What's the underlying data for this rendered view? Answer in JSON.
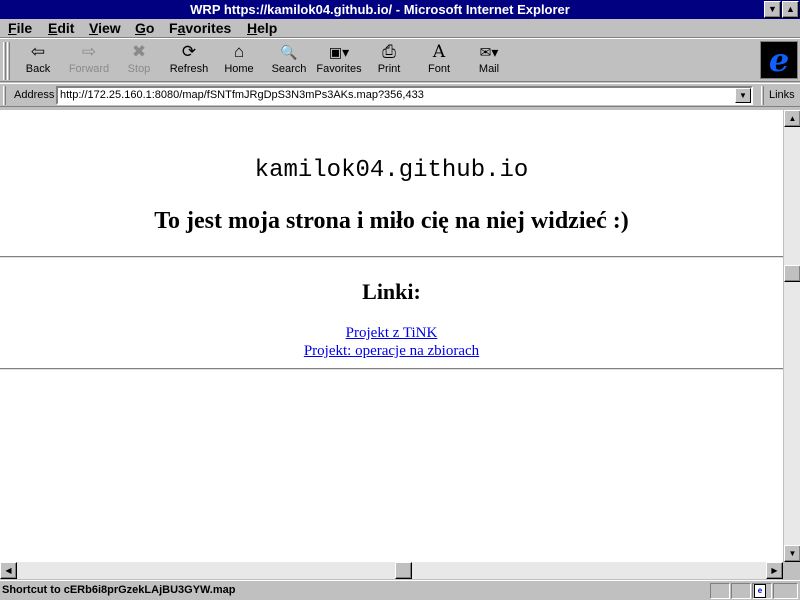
{
  "window": {
    "title": "WRP https://kamilok04.github.io/ - Microsoft Internet Explorer",
    "minimize_glyph": "▼",
    "maximize_glyph": "▲"
  },
  "menu": [
    {
      "label": "File",
      "mnemonic": "F"
    },
    {
      "label": "Edit",
      "mnemonic": "E"
    },
    {
      "label": "View",
      "mnemonic": "V"
    },
    {
      "label": "Go",
      "mnemonic": "G"
    },
    {
      "label": "Favorites",
      "mnemonic": "a"
    },
    {
      "label": "Help",
      "mnemonic": "H"
    }
  ],
  "toolbar": [
    {
      "label": "Back",
      "icon": "back-icon",
      "glyph": "⇦",
      "enabled": true
    },
    {
      "label": "Forward",
      "icon": "forward-icon",
      "glyph": "⇨",
      "enabled": false
    },
    {
      "label": "Stop",
      "icon": "stop-icon",
      "glyph": "✖",
      "enabled": false
    },
    {
      "label": "Refresh",
      "icon": "refresh-icon",
      "glyph": "⟳",
      "enabled": true
    },
    {
      "label": "Home",
      "icon": "home-icon",
      "glyph": "⌂",
      "enabled": true
    },
    {
      "label": "Search",
      "icon": "search-icon",
      "glyph": "🔍",
      "enabled": true
    },
    {
      "label": "Favorites",
      "icon": "favorites-icon",
      "glyph": "▣▾",
      "enabled": true
    },
    {
      "label": "Print",
      "icon": "print-icon",
      "glyph": "⎙",
      "enabled": true
    },
    {
      "label": "Font",
      "icon": "font-icon",
      "glyph": "A",
      "enabled": true
    },
    {
      "label": "Mail",
      "icon": "mail-icon",
      "glyph": "✉▾",
      "enabled": true
    }
  ],
  "address": {
    "label": "Address",
    "url": "http://172.25.160.1:8080/map/fSNTfmJRgDpS3N3mPs3AKs.map?356,433",
    "dropdown_glyph": "▼",
    "links_label": "Links"
  },
  "page": {
    "heading": "kamilok04.github.io",
    "subtitle": "To jest moja strona i miło cię na niej widzieć :)",
    "links_heading": "Linki:",
    "links": [
      "Projekt z TiNK",
      "Projekt: operacje na zbiorach"
    ]
  },
  "scrollbars": {
    "up_glyph": "▲",
    "down_glyph": "▼",
    "left_glyph": "◀",
    "right_glyph": "▶"
  },
  "status": {
    "text": "Shortcut to cERb6i8prGzekLAjBU3GYW.map",
    "zone_icon": "internet-zone-icon",
    "page_glyph": "e"
  }
}
